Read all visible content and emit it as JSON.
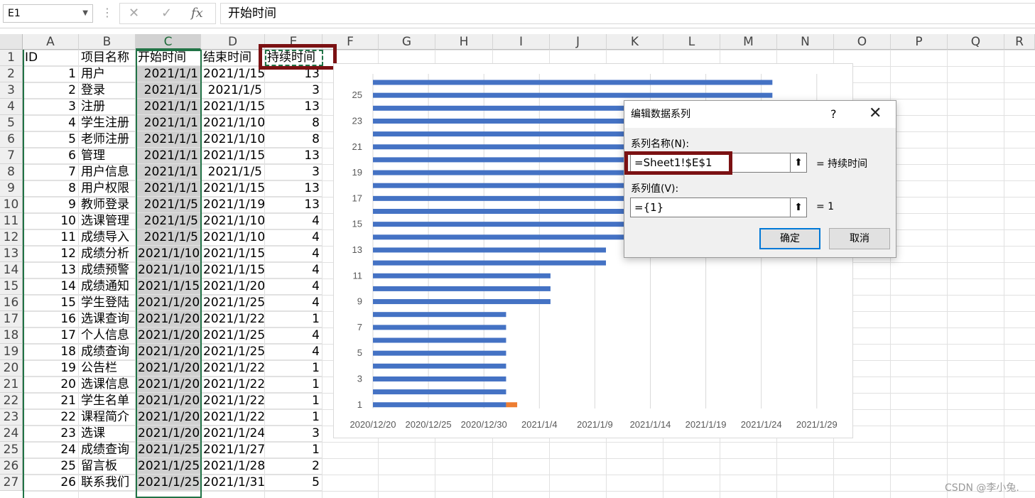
{
  "formula_bar": {
    "name_box": "E1",
    "formula": "开始时间",
    "cancel_icon": "✕",
    "enter_icon": "✓",
    "fx_label": "fx"
  },
  "columns": [
    "A",
    "B",
    "C",
    "D",
    "E",
    "F",
    "G",
    "H",
    "I",
    "J",
    "K",
    "L",
    "M",
    "N",
    "O",
    "P",
    "Q",
    "R"
  ],
  "rows": [
    {
      "n": "1",
      "a": "ID",
      "b": "项目名称",
      "c": "开始时间",
      "d": "结束时间",
      "e": "持续时间"
    },
    {
      "n": "2",
      "a": "1",
      "b": "用户",
      "c": "2021/1/1",
      "d": "2021/1/15",
      "e": "13"
    },
    {
      "n": "3",
      "a": "2",
      "b": "登录",
      "c": "2021/1/1",
      "d": "2021/1/5",
      "e": "3"
    },
    {
      "n": "4",
      "a": "3",
      "b": "注册",
      "c": "2021/1/1",
      "d": "2021/1/15",
      "e": "13"
    },
    {
      "n": "5",
      "a": "4",
      "b": "学生注册",
      "c": "2021/1/1",
      "d": "2021/1/10",
      "e": "8"
    },
    {
      "n": "6",
      "a": "5",
      "b": "老师注册",
      "c": "2021/1/1",
      "d": "2021/1/10",
      "e": "8"
    },
    {
      "n": "7",
      "a": "6",
      "b": "管理",
      "c": "2021/1/1",
      "d": "2021/1/15",
      "e": "13"
    },
    {
      "n": "8",
      "a": "7",
      "b": "用户信息",
      "c": "2021/1/1",
      "d": "2021/1/5",
      "e": "3"
    },
    {
      "n": "9",
      "a": "8",
      "b": "用户权限",
      "c": "2021/1/1",
      "d": "2021/1/15",
      "e": "13"
    },
    {
      "n": "10",
      "a": "9",
      "b": "教师登录",
      "c": "2021/1/5",
      "d": "2021/1/19",
      "e": "13"
    },
    {
      "n": "11",
      "a": "10",
      "b": "选课管理",
      "c": "2021/1/5",
      "d": "2021/1/10",
      "e": "4"
    },
    {
      "n": "12",
      "a": "11",
      "b": "成绩导入",
      "c": "2021/1/5",
      "d": "2021/1/10",
      "e": "4"
    },
    {
      "n": "13",
      "a": "12",
      "b": "成绩分析",
      "c": "2021/1/10",
      "d": "2021/1/15",
      "e": "4"
    },
    {
      "n": "14",
      "a": "13",
      "b": "成绩预警",
      "c": "2021/1/10",
      "d": "2021/1/15",
      "e": "4"
    },
    {
      "n": "15",
      "a": "14",
      "b": "成绩通知",
      "c": "2021/1/15",
      "d": "2021/1/20",
      "e": "4"
    },
    {
      "n": "16",
      "a": "15",
      "b": "学生登陆",
      "c": "2021/1/20",
      "d": "2021/1/25",
      "e": "4"
    },
    {
      "n": "17",
      "a": "16",
      "b": "选课查询",
      "c": "2021/1/20",
      "d": "2021/1/22",
      "e": "1"
    },
    {
      "n": "18",
      "a": "17",
      "b": "个人信息",
      "c": "2021/1/20",
      "d": "2021/1/25",
      "e": "4"
    },
    {
      "n": "19",
      "a": "18",
      "b": "成绩查询",
      "c": "2021/1/20",
      "d": "2021/1/25",
      "e": "4"
    },
    {
      "n": "20",
      "a": "19",
      "b": "公告栏",
      "c": "2021/1/20",
      "d": "2021/1/22",
      "e": "1"
    },
    {
      "n": "21",
      "a": "20",
      "b": "选课信息",
      "c": "2021/1/20",
      "d": "2021/1/22",
      "e": "1"
    },
    {
      "n": "22",
      "a": "21",
      "b": "学生名单",
      "c": "2021/1/20",
      "d": "2021/1/22",
      "e": "1"
    },
    {
      "n": "23",
      "a": "22",
      "b": "课程简介",
      "c": "2021/1/20",
      "d": "2021/1/22",
      "e": "1"
    },
    {
      "n": "24",
      "a": "23",
      "b": "选课",
      "c": "2021/1/20",
      "d": "2021/1/24",
      "e": "3"
    },
    {
      "n": "25",
      "a": "24",
      "b": "成绩查询",
      "c": "2021/1/25",
      "d": "2021/1/27",
      "e": "1"
    },
    {
      "n": "26",
      "a": "25",
      "b": "留言板",
      "c": "2021/1/25",
      "d": "2021/1/28",
      "e": "2"
    },
    {
      "n": "27",
      "a": "26",
      "b": "联系我们",
      "c": "2021/1/25",
      "d": "2021/1/31",
      "e": "5"
    }
  ],
  "dialog": {
    "title": "编辑数据系列",
    "help": "?",
    "close": "✕",
    "series_name_label": "系列名称(N):",
    "series_name_value": "=Sheet1!$E$1",
    "series_name_result": "= 持续时间",
    "series_values_label": "系列值(V):",
    "series_values_value": "={1}",
    "series_values_result": "= 1",
    "ok": "确定",
    "cancel": "取消",
    "ref_icon": "⬆"
  },
  "colors": {
    "bar_blue": "#4472c4",
    "bar_orange": "#ed7d31",
    "highlight_red": "#7b1113",
    "excel_green": "#217346"
  },
  "chart_data": {
    "type": "bar",
    "orientation": "horizontal",
    "x_tick_labels": [
      "2020/12/20",
      "2020/12/25",
      "2020/12/30",
      "2021/1/4",
      "2021/1/9",
      "2021/1/14",
      "2021/1/19",
      "2021/1/24",
      "2021/1/29"
    ],
    "xlim": [
      "2020/12/20",
      "2021/1/31"
    ],
    "y_tick_labels": [
      "1",
      "3",
      "5",
      "7",
      "9",
      "11",
      "13",
      "15",
      "17",
      "19",
      "21",
      "23",
      "25"
    ],
    "categories": [
      "1",
      "2",
      "3",
      "4",
      "5",
      "6",
      "7",
      "8",
      "9",
      "10",
      "11",
      "12",
      "13",
      "14",
      "15",
      "16",
      "17",
      "18",
      "19",
      "20",
      "21",
      "22",
      "23",
      "24",
      "25",
      "26"
    ],
    "series": [
      {
        "color": "#4472c4",
        "values": [
          "2021/1/1",
          "2021/1/1",
          "2021/1/1",
          "2021/1/1",
          "2021/1/1",
          "2021/1/1",
          "2021/1/1",
          "2021/1/1",
          "2021/1/5",
          "2021/1/5",
          "2021/1/5",
          "2021/1/10",
          "2021/1/10",
          "2021/1/15",
          "2021/1/20",
          "2021/1/20",
          "2021/1/20",
          "2021/1/20",
          "2021/1/20",
          "2021/1/20",
          "2021/1/20",
          "2021/1/20",
          "2021/1/20",
          "2021/1/25",
          "2021/1/25",
          "2021/1/25"
        ]
      },
      {
        "name": "持续时间",
        "color": "#ed7d31",
        "values": [
          1
        ]
      }
    ],
    "grid": true
  },
  "watermark": "CSDN @李小兔."
}
